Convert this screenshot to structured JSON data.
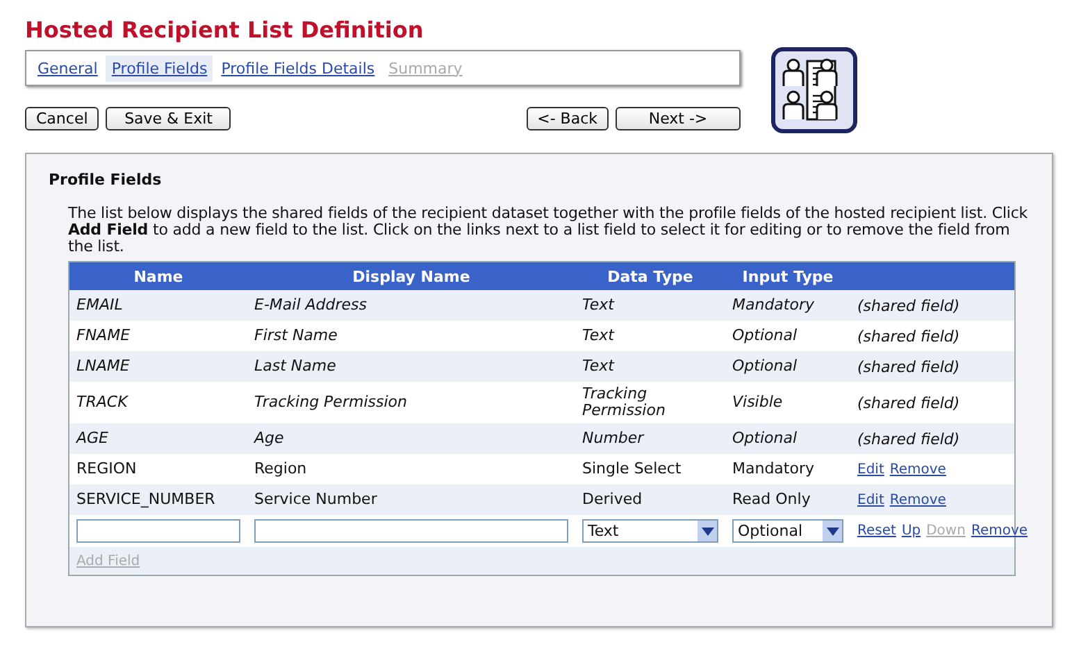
{
  "title": "Hosted Recipient List Definition",
  "tabs": [
    {
      "label": "General",
      "selected": false,
      "disabled": false
    },
    {
      "label": "Profile Fields",
      "selected": true,
      "disabled": false
    },
    {
      "label": "Profile Fields Details",
      "selected": false,
      "disabled": false
    },
    {
      "label": "Summary",
      "selected": false,
      "disabled": true
    }
  ],
  "left_buttons": [
    "Cancel",
    "Save & Exit"
  ],
  "right_buttons": [
    "<- Back",
    "Next ->"
  ],
  "section": {
    "heading": "Profile Fields",
    "intro": "The list below displays the shared fields of the recipient dataset together with the profile fields of the hosted recipient list. Click **Add Field** to add a new field to the list. Click on the links next to a list field to select it for editing or to remove the field from the list."
  },
  "table": {
    "columns": [
      "Name",
      "Display Name",
      "Data Type",
      "Input Type"
    ],
    "rows": [
      {
        "kind": "shared",
        "name": "EMAIL",
        "display_name": "E-Mail Address",
        "data_type": "Text",
        "input_type": "Mandatory",
        "note": "(shared field)"
      },
      {
        "kind": "shared",
        "name": "FNAME",
        "display_name": "First Name",
        "data_type": "Text",
        "input_type": "Optional",
        "note": "(shared field)"
      },
      {
        "kind": "shared",
        "name": "LNAME",
        "display_name": "Last Name",
        "data_type": "Text",
        "input_type": "Optional",
        "note": "(shared field)"
      },
      {
        "kind": "shared",
        "name": "TRACK",
        "display_name": "Tracking Permission",
        "data_type": "Tracking Permission",
        "input_type": "Visible",
        "note": "(shared field)"
      },
      {
        "kind": "shared",
        "name": "AGE",
        "display_name": "Age",
        "data_type": "Number",
        "input_type": "Optional",
        "note": "(shared field)"
      },
      {
        "kind": "custom",
        "name": "REGION",
        "display_name": "Region",
        "data_type": "Single Select",
        "input_type": "Mandatory",
        "links": [
          {
            "label": "Edit",
            "disabled": false
          },
          {
            "label": "Remove",
            "disabled": false
          }
        ]
      },
      {
        "kind": "custom",
        "name": "SERVICE_NUMBER",
        "display_name": "Service Number",
        "data_type": "Derived",
        "input_type": "Read Only",
        "links": [
          {
            "label": "Edit",
            "disabled": false
          },
          {
            "label": "Remove",
            "disabled": false
          }
        ]
      },
      {
        "kind": "new",
        "data_type": "Text",
        "input_type": "Optional",
        "links": [
          {
            "label": "Reset",
            "disabled": false
          },
          {
            "label": "Up",
            "disabled": false
          },
          {
            "label": "Down",
            "disabled": true
          },
          {
            "label": "Remove",
            "disabled": false
          }
        ]
      }
    ],
    "footer_link": {
      "label": "Add Field",
      "disabled": true
    }
  }
}
